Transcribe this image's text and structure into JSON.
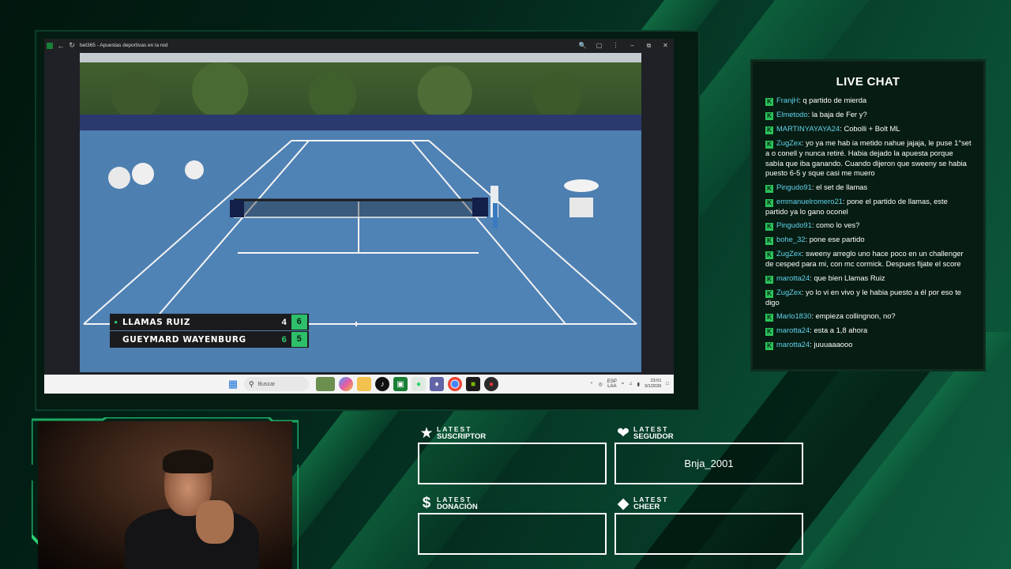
{
  "browser": {
    "title": "bet365 - Apuestas deportivas en la red"
  },
  "scoreboard": {
    "players": [
      {
        "name": "LLAMAS RUIZ",
        "games": "4",
        "sets": "6",
        "serving": true
      },
      {
        "name": "GUEYMARD WAYENBURG",
        "games": "6",
        "sets": "5",
        "serving": false
      }
    ]
  },
  "taskbar": {
    "search_placeholder": "Buscar",
    "lang_top": "ESP",
    "lang_bottom": "LAA",
    "time": "23:01",
    "date": "3/1/2026"
  },
  "chat": {
    "title": "LIVE CHAT",
    "badge": "K",
    "messages": [
      {
        "user": "FranjH",
        "text": "q partido de mierda"
      },
      {
        "user": "Elmetodo",
        "text": "la baja de Fer y?"
      },
      {
        "user": "MARTINYAYAYA24",
        "text": "Cobolli + Bolt ML"
      },
      {
        "user": "ZugZex",
        "text": "yo ya me hab ia metido nahue jajaja, le puse 1°set a o conell y nunca retiré. Habia dejado la apuesta porque sabía que iba ganando. Cuando dijeron que sweeny se habia puesto 6-5 y sque casi me muero"
      },
      {
        "user": "Pingudo91",
        "text": "el set de llamas"
      },
      {
        "user": "emmanuelromero21",
        "text": "pone el partido de llamas, este partido ya lo gano oconel"
      },
      {
        "user": "Pingudo91",
        "text": "como lo ves?"
      },
      {
        "user": "bohe_32",
        "text": "pone ese partido"
      },
      {
        "user": "ZugZex",
        "text": "sweeny arreglo uno hace poco en un challenger de cesped para mi, con mc cormick. Despues fijate el score"
      },
      {
        "user": "marotta24",
        "text": "que bien Llamas Ruiz"
      },
      {
        "user": "ZugZex",
        "text": "yo lo vi en vivo y le habia puesto a él por eso te digo"
      },
      {
        "user": "Marlo1830",
        "text": "empieza collingnon, no?"
      },
      {
        "user": "marotta24",
        "text": "esta a 1,8 ahora"
      },
      {
        "user": "marotta24",
        "text": "juuuaaaooo"
      }
    ]
  },
  "latest": {
    "suscriptor": {
      "line1": "LATEST",
      "line2": "SUSCRIPTOR",
      "icon": "star-icon",
      "value": ""
    },
    "seguidor": {
      "line1": "LATEST",
      "line2": "SEGUIDOR",
      "icon": "heart-icon",
      "value": "Bnja_2001"
    },
    "donacion": {
      "line1": "LATEST",
      "line2": "DONACIÓN",
      "icon": "dollar-icon",
      "value": ""
    },
    "cheer": {
      "line1": "LATEST",
      "line2": "CHEER",
      "icon": "diamond-icon",
      "value": ""
    }
  },
  "colors": {
    "accent_green": "#2bc25a",
    "chat_username": "#5fd3ee",
    "background_dark": "#031a10"
  }
}
